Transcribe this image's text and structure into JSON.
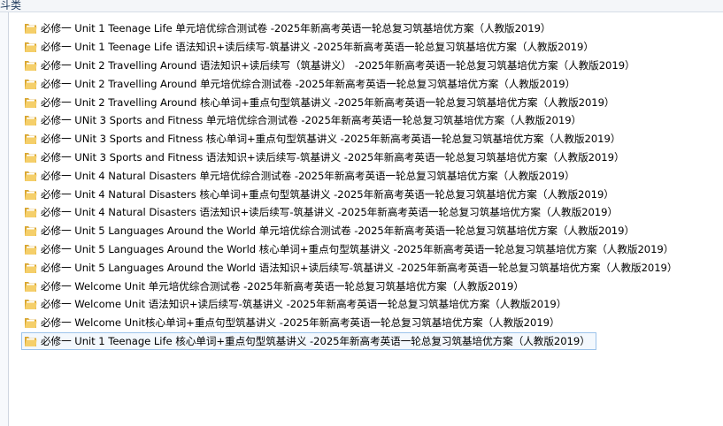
{
  "header": {
    "label": "斗类"
  },
  "colors": {
    "folder_back": "#d9a630",
    "folder_front": "#f5cf6a",
    "selection_border": "#9cc3ea",
    "selection_fill": "#f3f8fd"
  },
  "files": [
    {
      "name": "必修一  Unit 1 Teenage Life  单元培优综合测试卷 -2025年新高考英语一轮总复习筑基培优方案（人教版2019）",
      "icon": "folder-icon",
      "selected": false
    },
    {
      "name": "必修一  Unit 1 Teenage Life  语法知识+读后续写-筑基讲义 -2025年新高考英语一轮总复习筑基培优方案（人教版2019）",
      "icon": "folder-icon",
      "selected": false
    },
    {
      "name": "必修一  Unit 2 Travelling Around  语法知识+读后续写（筑基讲义） -2025年新高考英语一轮总复习筑基培优方案（人教版2019）",
      "icon": "folder-icon",
      "selected": false
    },
    {
      "name": "必修一  Unit 2 Travelling Around 单元培优综合测试卷 -2025年新高考英语一轮总复习筑基培优方案（人教版2019）",
      "icon": "folder-icon",
      "selected": false
    },
    {
      "name": "必修一  Unit 2 Travelling Around 核心单词+重点句型筑基讲义 -2025年新高考英语一轮总复习筑基培优方案（人教版2019）",
      "icon": "folder-icon",
      "selected": false
    },
    {
      "name": "必修一  UNit 3 Sports and Fitness 单元培优综合测试卷 -2025年新高考英语一轮总复习筑基培优方案（人教版2019）",
      "icon": "folder-icon",
      "selected": false
    },
    {
      "name": "必修一  UNit 3 Sports and Fitness 核心单词+重点句型筑基讲义 -2025年新高考英语一轮总复习筑基培优方案（人教版2019）",
      "icon": "folder-icon",
      "selected": false
    },
    {
      "name": "必修一  UNit 3 Sports and Fitness 语法知识+读后续写-筑基讲义 -2025年新高考英语一轮总复习筑基培优方案（人教版2019）",
      "icon": "folder-icon",
      "selected": false
    },
    {
      "name": "必修一  Unit 4 Natural Disasters 单元培优综合测试卷 -2025年新高考英语一轮总复习筑基培优方案（人教版2019）",
      "icon": "folder-icon",
      "selected": false
    },
    {
      "name": "必修一  Unit 4 Natural Disasters 核心单词+重点句型筑基讲义 -2025年新高考英语一轮总复习筑基培优方案（人教版2019）",
      "icon": "folder-icon",
      "selected": false
    },
    {
      "name": "必修一  Unit 4 Natural Disasters 语法知识+读后续写-筑基讲义 -2025年新高考英语一轮总复习筑基培优方案（人教版2019）",
      "icon": "folder-icon",
      "selected": false
    },
    {
      "name": "必修一  Unit 5 Languages Around the World 单元培优综合测试卷 -2025年新高考英语一轮总复习筑基培优方案（人教版2019）",
      "icon": "folder-icon",
      "selected": false
    },
    {
      "name": "必修一  Unit 5 Languages Around the World 核心单词+重点句型筑基讲义 -2025年新高考英语一轮总复习筑基培优方案（人教版2019）",
      "icon": "folder-icon",
      "selected": false
    },
    {
      "name": "必修一  Unit 5 Languages Around the World 语法知识+读后续写-筑基讲义 -2025年新高考英语一轮总复习筑基培优方案（人教版2019）",
      "icon": "folder-icon",
      "selected": false
    },
    {
      "name": "必修一  Welcome Unit 单元培优综合测试卷 -2025年新高考英语一轮总复习筑基培优方案（人教版2019）",
      "icon": "folder-icon",
      "selected": false
    },
    {
      "name": "必修一  Welcome Unit 语法知识+读后续写-筑基讲义 -2025年新高考英语一轮总复习筑基培优方案（人教版2019）",
      "icon": "folder-icon",
      "selected": false
    },
    {
      "name": "必修一  Welcome Unit核心单词+重点句型筑基讲义 -2025年新高考英语一轮总复习筑基培优方案（人教版2019）",
      "icon": "folder-icon",
      "selected": false
    },
    {
      "name": "必修一 Unit 1 Teenage Life  核心单词+重点句型筑基讲义 -2025年新高考英语一轮总复习筑基培优方案（人教版2019）",
      "icon": "folder-icon",
      "selected": true
    }
  ]
}
